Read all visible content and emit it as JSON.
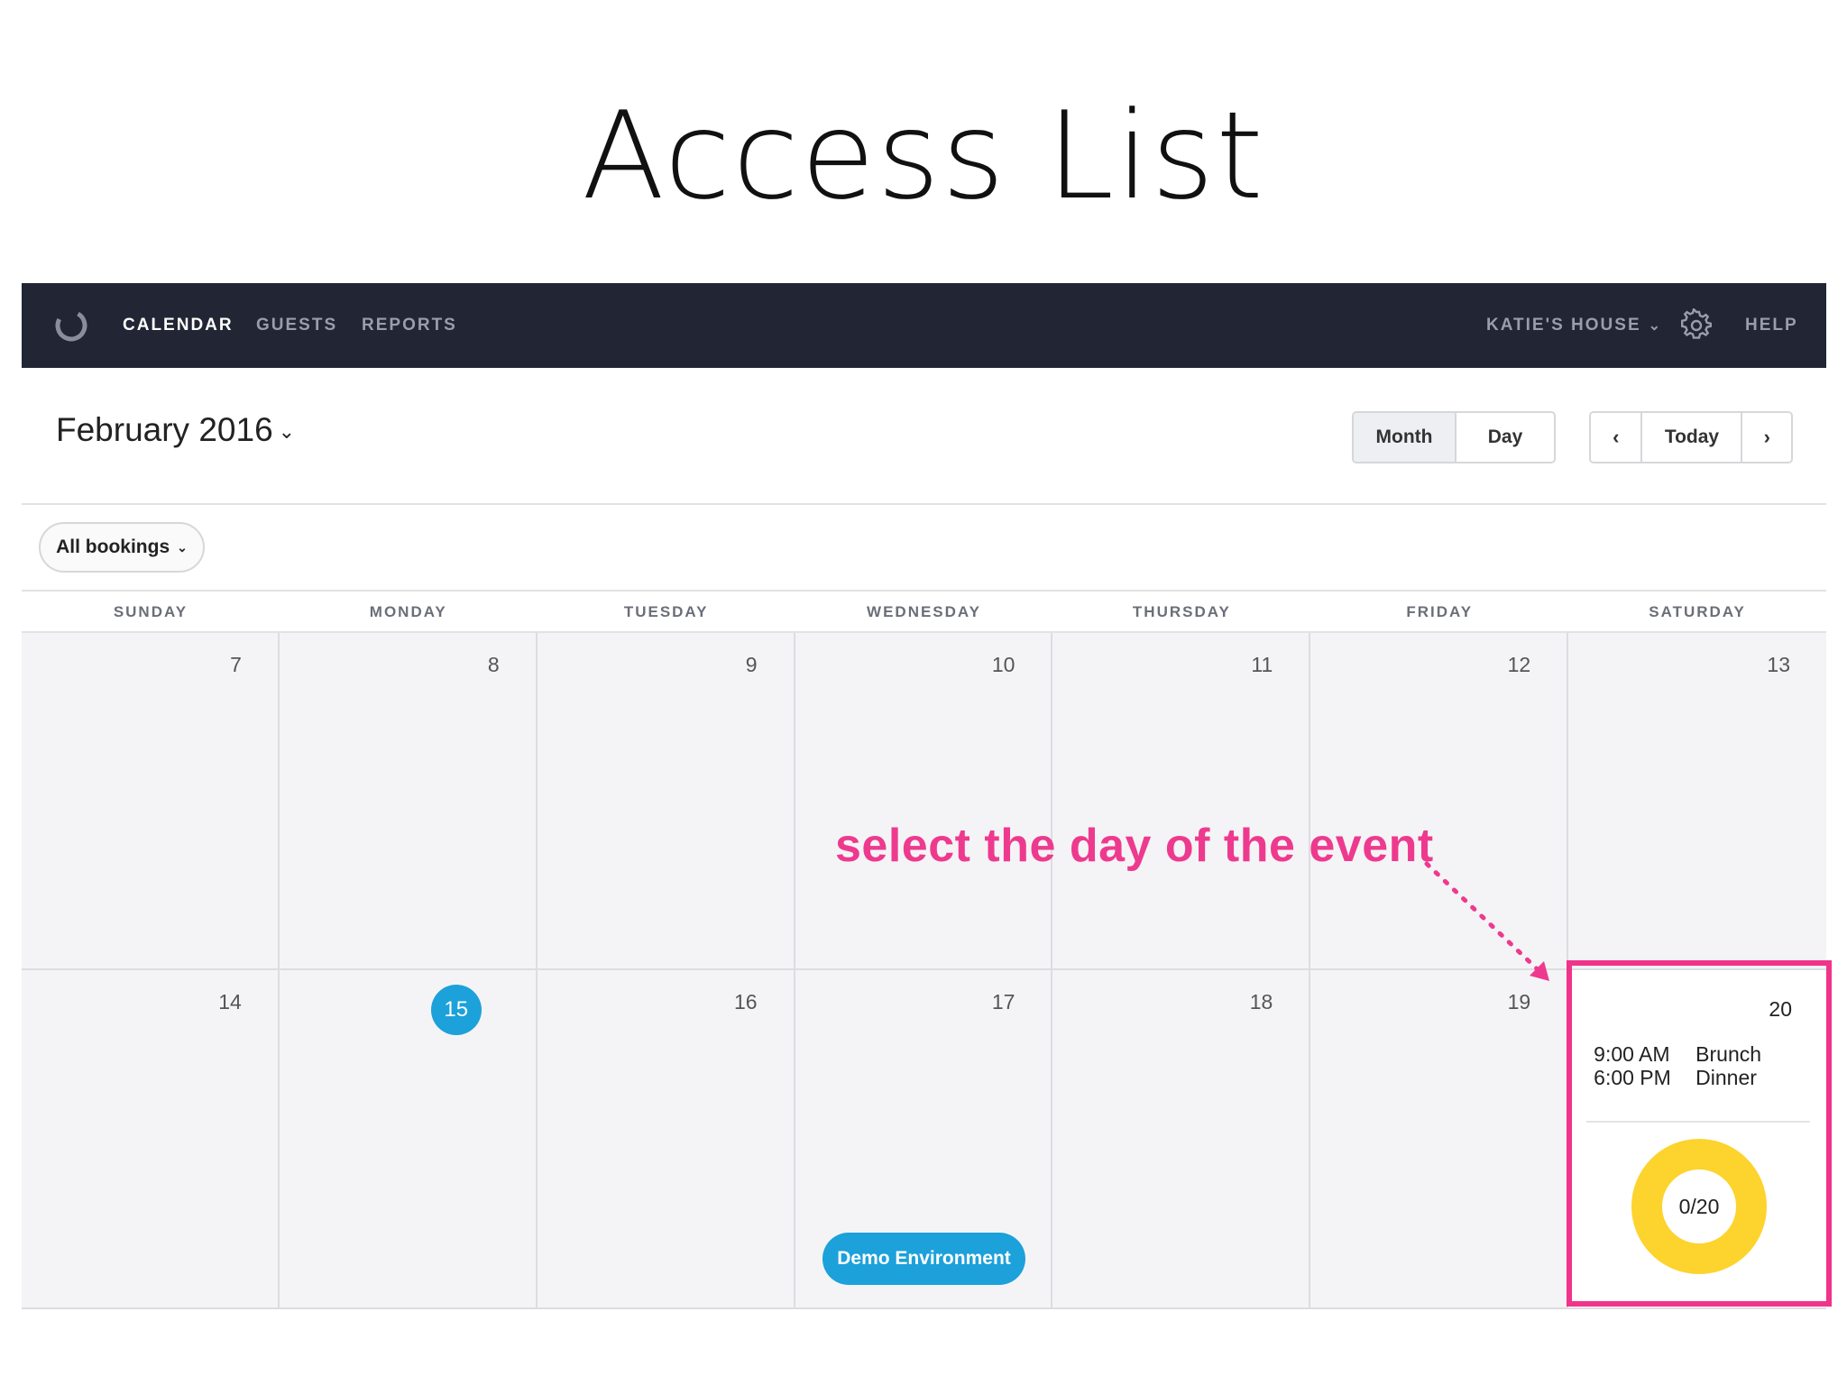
{
  "slide": {
    "title": "Access List"
  },
  "navbar": {
    "items": [
      {
        "label": "CALENDAR",
        "active": true
      },
      {
        "label": "GUESTS",
        "active": false
      },
      {
        "label": "REPORTS",
        "active": false
      }
    ],
    "venue": "KATIE'S HOUSE",
    "help_label": "HELP",
    "icons": {
      "logo": "loading-ring-logo-icon",
      "settings": "gear-icon"
    }
  },
  "toolbar": {
    "month_label": "February 2016",
    "view_buttons": {
      "month": "Month",
      "day": "Day",
      "active": "Month"
    },
    "nav_buttons": {
      "prev": "‹",
      "today": "Today",
      "next": "›"
    }
  },
  "filter": {
    "label": "All bookings"
  },
  "weekdays": [
    "SUNDAY",
    "MONDAY",
    "TUESDAY",
    "WEDNESDAY",
    "THURSDAY",
    "FRIDAY",
    "SATURDAY"
  ],
  "weeks": [
    {
      "days": [
        "7",
        "8",
        "9",
        "10",
        "11",
        "12",
        "13"
      ]
    },
    {
      "days": [
        "14",
        "15",
        "16",
        "17",
        "18",
        "19",
        "20"
      ]
    }
  ],
  "today": "15",
  "demo_environment": {
    "label": "Demo Environment"
  },
  "selected_day": {
    "date": "20",
    "events": [
      {
        "time": "9:00 AM",
        "name": "Brunch"
      },
      {
        "time": "6:00 PM",
        "name": "Dinner"
      }
    ],
    "capacity": {
      "label": "0/20",
      "booked": 0,
      "total": 20
    }
  },
  "annotation": {
    "text": "select the day of the event",
    "color": "#ee3a8e"
  },
  "colors": {
    "navbar": "#212534",
    "accent": "#1ca1da",
    "donut": "#fdd32d",
    "highlight": "#f0338b"
  }
}
